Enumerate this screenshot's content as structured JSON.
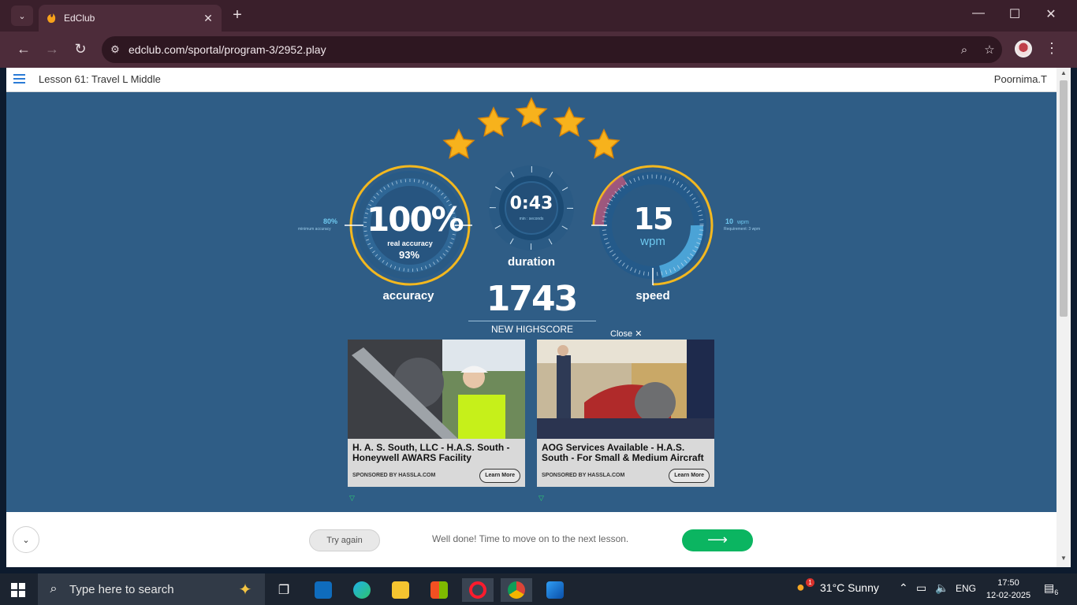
{
  "browser": {
    "tab_title": "EdClub",
    "url": "edclub.com/sportal/program-3/2952.play"
  },
  "lesson": {
    "title": "Lesson 61: Travel L Middle",
    "user": "Poornima.T"
  },
  "results": {
    "stars": 5,
    "accuracy": {
      "value": "100%",
      "real_label": "real accuracy",
      "real_value": "93%",
      "min_value": "80%",
      "min_label": "minimum accuracy",
      "caption": "accuracy"
    },
    "duration": {
      "value": "0:43",
      "unit": "min : seconds",
      "caption": "duration"
    },
    "speed": {
      "value": "15",
      "unit": "wpm",
      "req_value": "10",
      "req_unit": "wpm",
      "req_label": "Requirement: 3 wpm",
      "caption": "speed"
    },
    "score": "1743",
    "score_label": "NEW HIGHSCORE",
    "close_label": "Close"
  },
  "ads": [
    {
      "title": "H. A. S. South, LLC - H.A.S. South - Honeywell AWARS Facility",
      "sponsor": "SPONSORED BY HASSLA.COM",
      "button": "Learn More"
    },
    {
      "title": "AOG Services Available - H.A.S. South - For Small & Medium Aircraft",
      "sponsor": "SPONSORED BY HASSLA.COM",
      "button": "Learn More"
    }
  ],
  "footer": {
    "try_again": "Try again",
    "message": "Well done! Time to move on to the next lesson.",
    "next_arrow": "⟶"
  },
  "taskbar": {
    "search_placeholder": "Type here to search",
    "weather": "31°C  Sunny",
    "language": "ENG",
    "time": "17:50",
    "date": "12-02-2025",
    "notification_count": "6",
    "weather_badge": "1"
  },
  "colors": {
    "page_bg": "#2f5d86",
    "gauge_gold": "#f3b81f",
    "accent_blue": "#6ec8ef",
    "next_green": "#0bb561"
  }
}
